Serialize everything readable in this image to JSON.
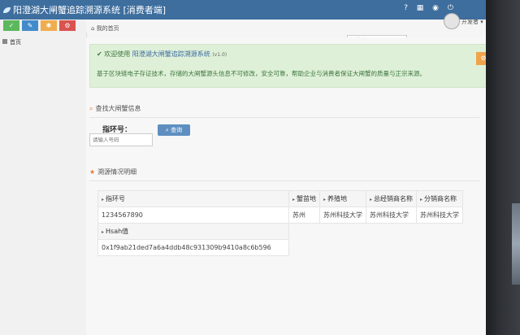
{
  "app": {
    "title": "阳澄湖大闸蟹追踪溯源系统 [消费者端]",
    "username": "开发者"
  },
  "toolbar": {
    "buttons": [
      {
        "icon": "check-icon",
        "glyph": "✓",
        "color": "#5cb85c"
      },
      {
        "icon": "pencil-icon",
        "glyph": "✎",
        "color": "#428bca"
      },
      {
        "icon": "group-icon",
        "glyph": "✱",
        "color": "#f0ad4e"
      },
      {
        "icon": "settings-icon",
        "glyph": "⚙",
        "color": "#d9534f"
      }
    ]
  },
  "breadcrumb": {
    "label": "我的首页"
  },
  "search": {
    "placeholder": "搜索"
  },
  "sidebar": {
    "items": [
      {
        "label": "首页"
      }
    ]
  },
  "alert": {
    "prefix": "欢迎使用",
    "system_name": "阳澄湖大闸蟹追踪溯源系统",
    "version": "(v1.0)",
    "description": "基于区块链电子存证技术，存储的大闸蟹源头信息不可修改，安全可靠，帮助企业与消费者保证大闸蟹的质量与正宗来源。"
  },
  "find_section": {
    "title": "查找大闸蟹信息",
    "field_label": "指环号：",
    "input_placeholder": "请输入号码",
    "query_button": "查询"
  },
  "detail_section": {
    "title": "溯源情况明细",
    "headers": {
      "ring_no": "指环号",
      "crab_origin": "蟹苗地",
      "farm_site": "养殖地",
      "distributor": "总经销商名称",
      "sub_distributor": "分销商名称",
      "hash": "Hsah值"
    },
    "values": {
      "ring_no": "1234567890",
      "crab_origin": "苏州",
      "farm_site": "苏州科技大学",
      "distributor": "苏州科技大学",
      "sub_distributor": "苏州科技大学",
      "hash": "0x1f9ab21ded7a6a4ddb48c931309b9410a8c6b596"
    }
  }
}
